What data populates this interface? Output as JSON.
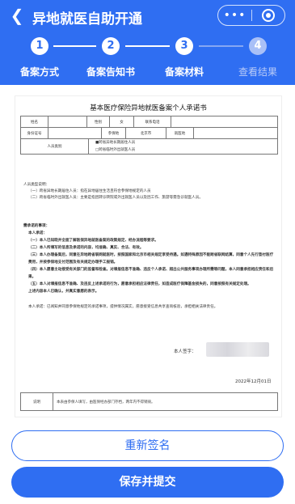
{
  "header": {
    "title": "异地就医自助开通",
    "more_icon": "ellipsis-icon",
    "target_icon": "target-icon"
  },
  "steps": [
    {
      "num": "1",
      "label": "备案方式"
    },
    {
      "num": "2",
      "label": "备案告知书"
    },
    {
      "num": "3",
      "label": "备案材料"
    },
    {
      "num": "4",
      "label": "查看结果"
    }
  ],
  "document": {
    "title": "基本医疗保险异地就医备案个人承诺书",
    "fields": {
      "name_label": "姓名",
      "gender_label": "性别",
      "gender_value": "女",
      "phone_label": "联系电话",
      "id_label": "身份证号",
      "insured_place_label": "参保地",
      "insured_place_value": "北京市",
      "residence_label": "就医地",
      "person_type_label": "人员类别"
    },
    "type_options": [
      "■跨省异地长期居住人员",
      "□跨省临时外出就医人员"
    ],
    "instructions": [
      "人员类型说明：",
      "（一）跨省异地长期居住人员：指在异地居住生活且符合参保地规定的人员",
      "（二）跨省临时外出就医人员：主要是指因转诊转院或外出就医人员以及因工作、旅游等需急诊就医人员。"
    ],
    "commitment_heading": "需承诺的事项：",
    "commitment_intro": "本人承诺：",
    "commitments": [
      "（一）本人已知晓并全面了解医保异地就医备案的政策规定、经办流程等要求。",
      "（二）本人所填写的信息及承诺的内容，均准确、真实、合法、有效。",
      "（三）本人办理备案后，同意在异地跨省联网就医时，按照国家和北京市相关规定享受待遇。如遇特殊原因不能跨省联网结算，同意个人先行垫付医疗费用，并按参保地支付范围及有关规定办理手工报销。",
      "（四）本人愿意主动接受有关部门的监督和检查。对填报信息不准确、违反个人承诺、超出公共服务事项办理所需等问题，本人同意承担相应责任和后果。",
      "（五）本人对填报信息不准确、及违反上述承诺的行为，愿意承担相应法律责任，如造成医疗保障基金损失的，同意按照有关规定处理。",
      "上述内容本人已确认，并真实意愿的表示。"
    ],
    "final_statement": "本人承诺：已阅知并同意参保地规定的承诺事项，提供情况属实，愿意接受信息共享查询核验，承担相关法律责任。",
    "signer_label": "本人签字：",
    "date": "2022年12月01日",
    "note_label": "说明",
    "note_text": "本表由参保人填写，由医保经办部门存档，两年内不得销毁。"
  },
  "buttons": {
    "resign": "重新签名",
    "submit": "保存并提交"
  },
  "colors": {
    "primary": "#2f6ef2"
  }
}
